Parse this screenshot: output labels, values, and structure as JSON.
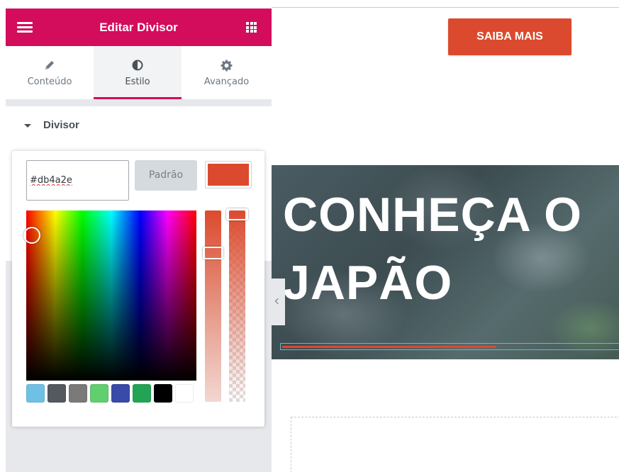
{
  "panel": {
    "title": "Editar Divisor",
    "header_color": "#d30c5c",
    "tabs": [
      {
        "label": "Conteúdo",
        "icon": "pencil-icon",
        "active": false
      },
      {
        "label": "Estilo",
        "icon": "half-circle-icon",
        "active": true
      },
      {
        "label": "Avançado",
        "icon": "gear-icon",
        "active": false
      }
    ],
    "section": {
      "label": "Divisor",
      "expanded": true
    }
  },
  "color_picker": {
    "hex_value": "#db4a2e",
    "default_label": "Padrão",
    "current_color": "#db4a2e",
    "palette": [
      "#61ce70",
      "#4d5256",
      "#7a7a7a",
      "#61ce70",
      "#2e4fa8",
      "#1fa05a",
      "#000000",
      "#ffffff"
    ],
    "palette_real": [
      "#6ec1e4",
      "#54595f",
      "#7a7a7a",
      "#61ce70",
      "#3a4aa8",
      "#23a455",
      "#000000",
      "#ffffff"
    ]
  },
  "preview": {
    "cta_label": "SAIBA MAIS",
    "cta_color": "#db4a2e",
    "hero_title_line1": "CONHEÇA O",
    "hero_title_line2": "JAPÃO",
    "divider_color": "#db4a2e"
  }
}
